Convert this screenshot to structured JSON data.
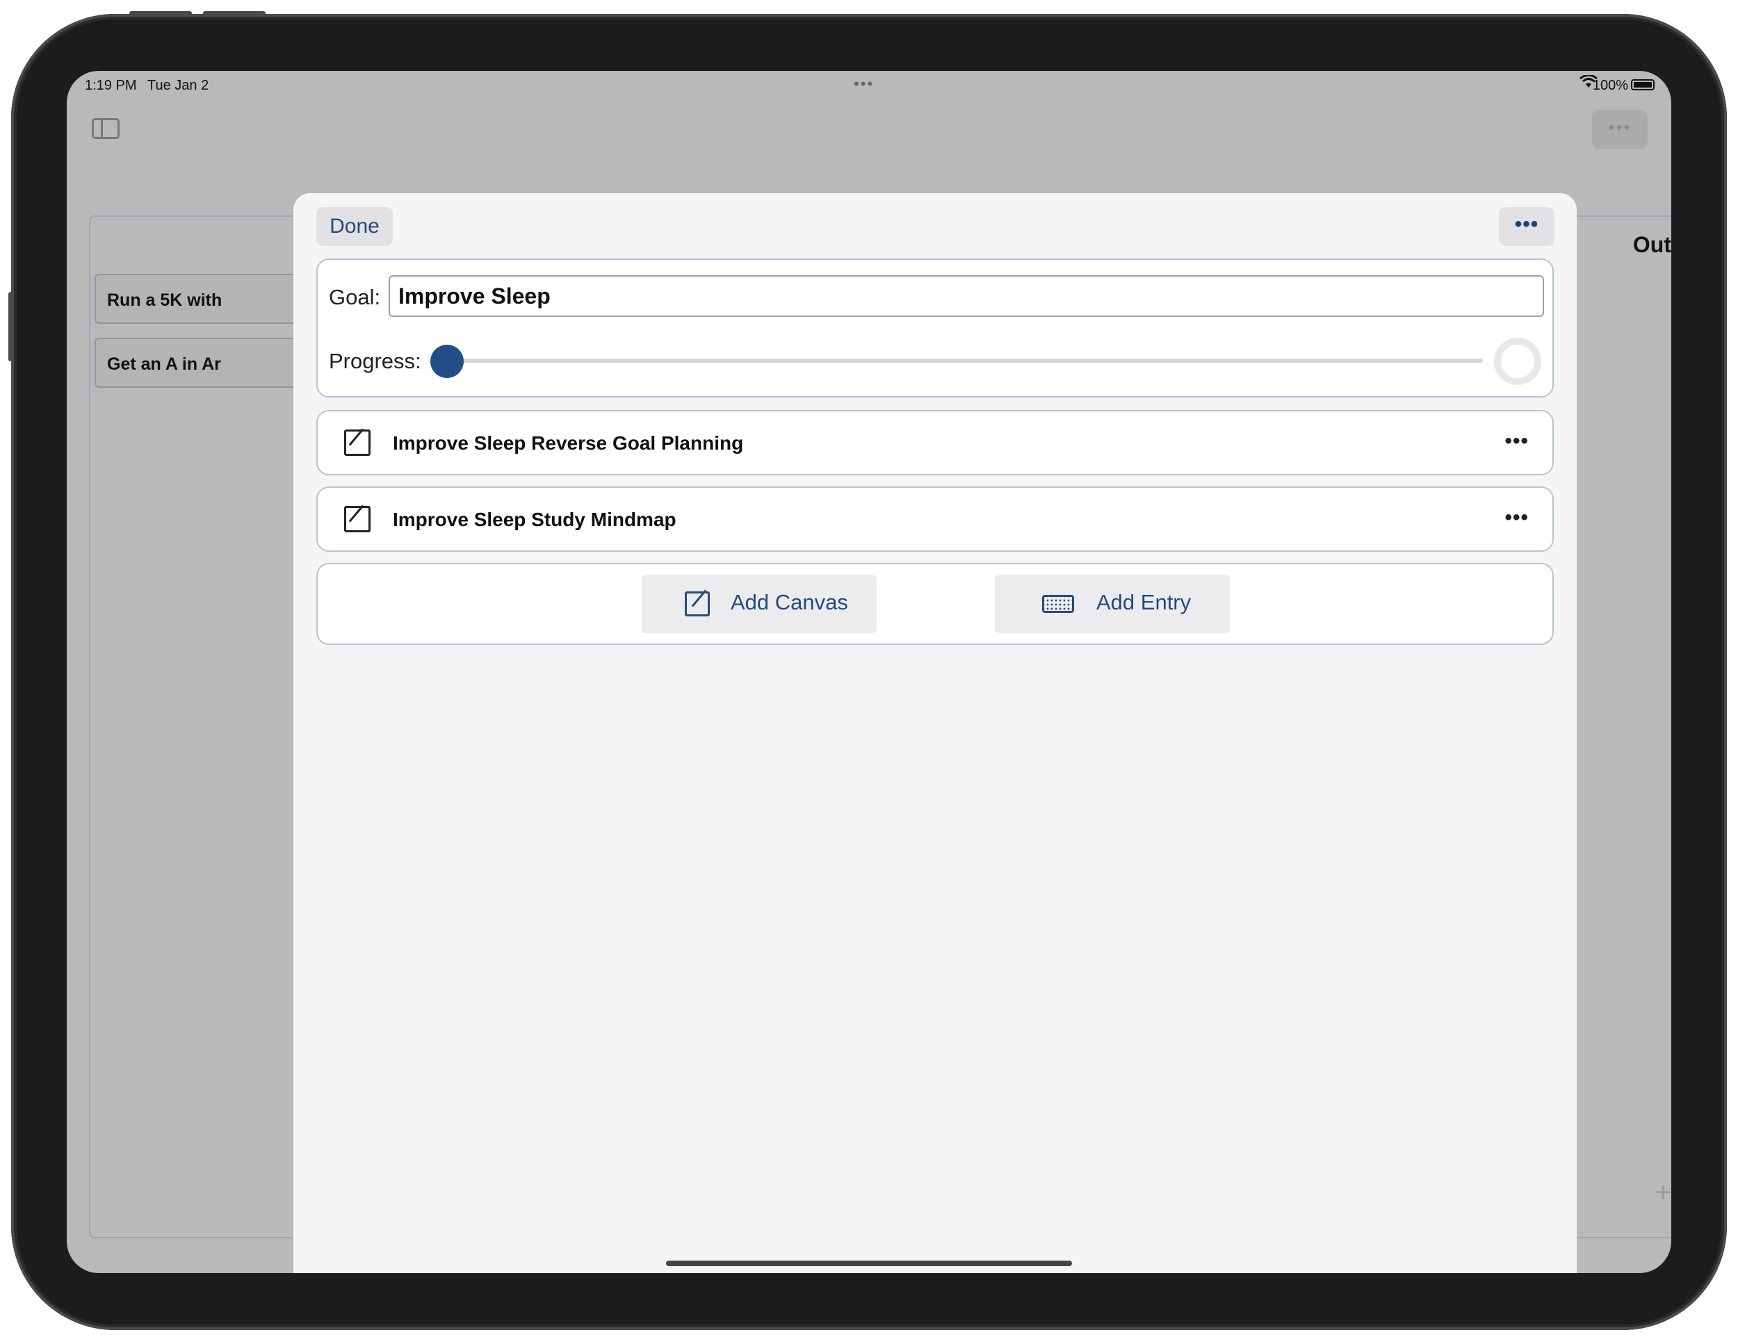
{
  "status_bar": {
    "time": "1:19 PM",
    "date": "Tue Jan 2",
    "battery": "100%"
  },
  "background": {
    "cards": [
      "Run a 5K with",
      "Get an A in Ar"
    ],
    "right_heading": "Out"
  },
  "modal": {
    "done_label": "Done",
    "more_label": "•••",
    "goal_label": "Goal:",
    "goal_value": "Improve Sleep",
    "progress_label": "Progress:",
    "progress_value": 0,
    "entries": [
      {
        "title": "Improve Sleep Reverse Goal Planning",
        "more": "•••",
        "icon": "edit-canvas-icon"
      },
      {
        "title": "Improve Sleep Study Mindmap",
        "more": "•••",
        "icon": "edit-canvas-icon"
      }
    ],
    "actions": {
      "add_canvas": "Add Canvas",
      "add_entry": "Add Entry"
    }
  },
  "colors": {
    "accent": "#274a7e",
    "slider_thumb": "#224e88",
    "modal_bg": "#f5f5f5",
    "card_border": "#b7c4d6"
  }
}
